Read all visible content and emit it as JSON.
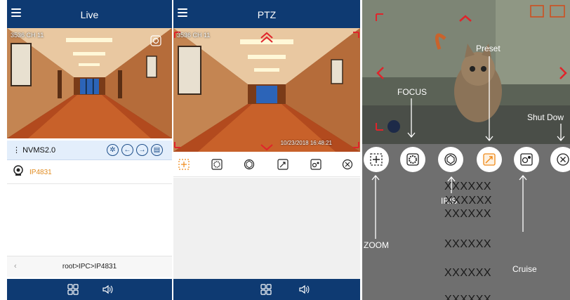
{
  "live_screen": {
    "title": "Live",
    "video_label": "3536  CH 11",
    "device": {
      "name": "NVMS2.0",
      "menu_glyph": "⋮"
    },
    "channel": {
      "name": "IP4831"
    },
    "breadcrumb": {
      "back_glyph": "‹",
      "path": "root>IPC>IP4831"
    }
  },
  "ptz_screen": {
    "title": "PTZ",
    "video_label": "3536  CH 11",
    "timestamp": "10/23/2018  16:48:21",
    "toolbar": [
      "zoom-icon",
      "focus-icon",
      "iris-icon",
      "preset-icon",
      "cruise-icon",
      "close-icon"
    ]
  },
  "guide_screen": {
    "annotations": {
      "zoom": "ZOOM",
      "focus": "FOCUS",
      "iris": "IRIS",
      "preset": "Preset",
      "cruise": "Cruise",
      "shutdown": "Shut Dow"
    },
    "placeholder_rows": [
      "XXXXXX",
      "XXXXXX",
      "XXXXXX",
      "XXXXXX",
      "XXXXXX",
      "XXXXXX"
    ]
  },
  "colors": {
    "appbar": "#0e3a72",
    "accent_red": "#e0242b",
    "accent_orange": "#f08a1a",
    "selection_bg": "#e3eefb"
  },
  "icons": {
    "grid": "grid-icon",
    "speaker": "speaker-icon",
    "menu": "hamburger-menu-icon"
  }
}
